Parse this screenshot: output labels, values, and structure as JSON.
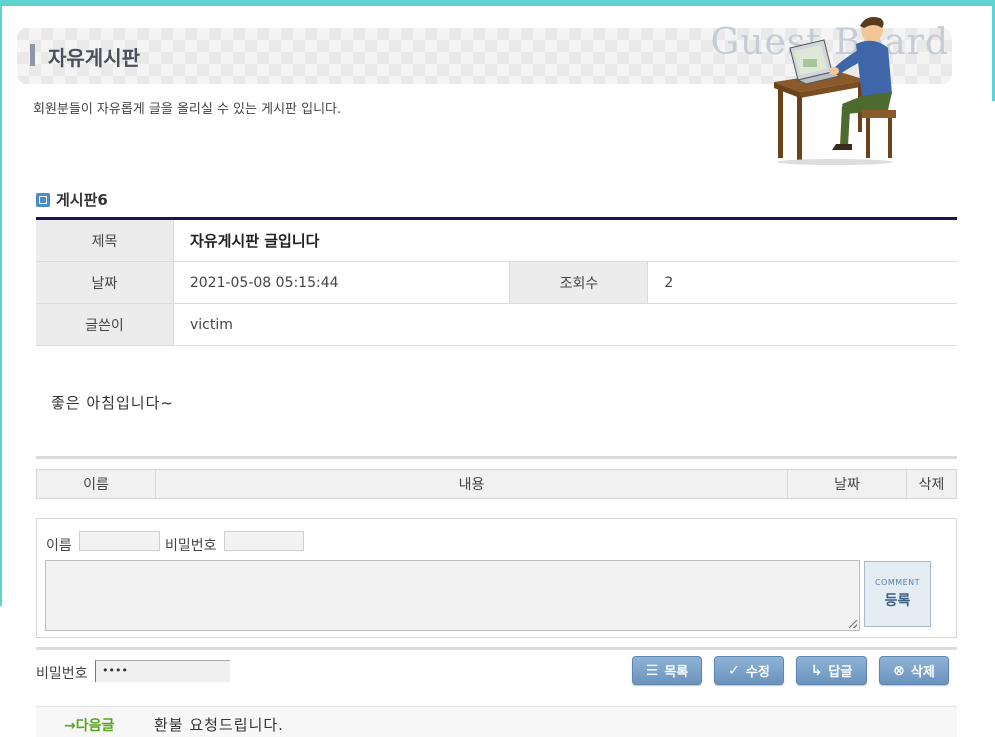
{
  "header": {
    "title": "자유게시판",
    "watermark": "Guest Board",
    "description": "회원분들이 자유롭게 글을 올리실 수 있는 게시판 입니다."
  },
  "board": {
    "name": "게시판6"
  },
  "post": {
    "title_label": "제목",
    "title": "자유게시판 글입니다",
    "date_label": "날짜",
    "date": "2021-05-08 05:15:44",
    "views_label": "조회수",
    "views": "2",
    "author_label": "글쓴이",
    "author": "victim",
    "body": "좋은 아침입니다~"
  },
  "comments": {
    "columns": [
      "이름",
      "내용",
      "날짜",
      "삭제"
    ]
  },
  "comment_form": {
    "name_label": "이름",
    "password_label": "비밀번호",
    "submit_small": "COMMENT",
    "submit_label": "등록"
  },
  "actions": {
    "password_label": "비밀번호",
    "password_value": "••••",
    "list": "목록",
    "edit": "수정",
    "reply": "답글",
    "delete": "삭제"
  },
  "nav": {
    "next_label": "→다음글",
    "next_title": "환불 요청드립니다."
  },
  "colors": {
    "accent": "#5fd3d0",
    "table_top_border": "#221155",
    "button": "#7aa1c8",
    "next_label": "#5aa51e"
  }
}
